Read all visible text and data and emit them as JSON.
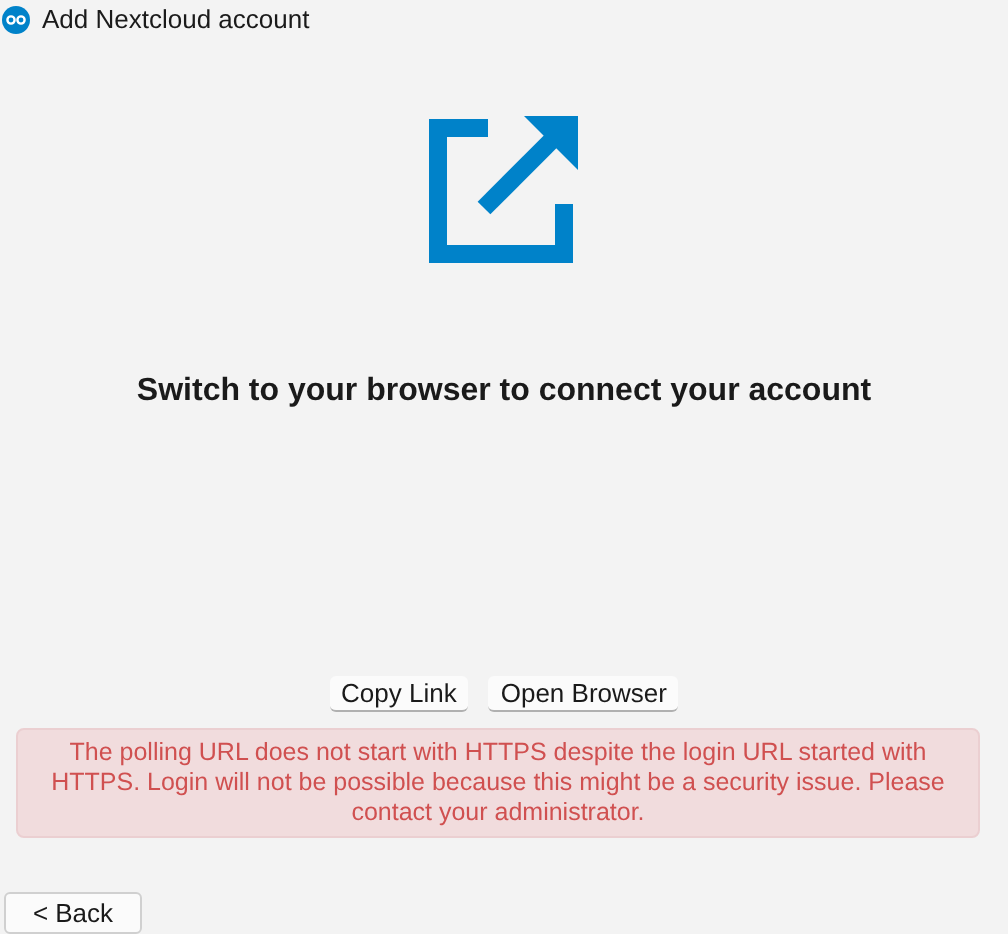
{
  "window": {
    "title": "Add Nextcloud account"
  },
  "heading": "Switch to your browser to connect your account",
  "buttons": [
    "Copy Link",
    "Open Browser"
  ],
  "error_message": "The polling URL does not start with HTTPS despite the login URL started with HTTPS. Login will not be possible because this might be a security issue. Please contact your administrator.",
  "back_button": "< Back"
}
